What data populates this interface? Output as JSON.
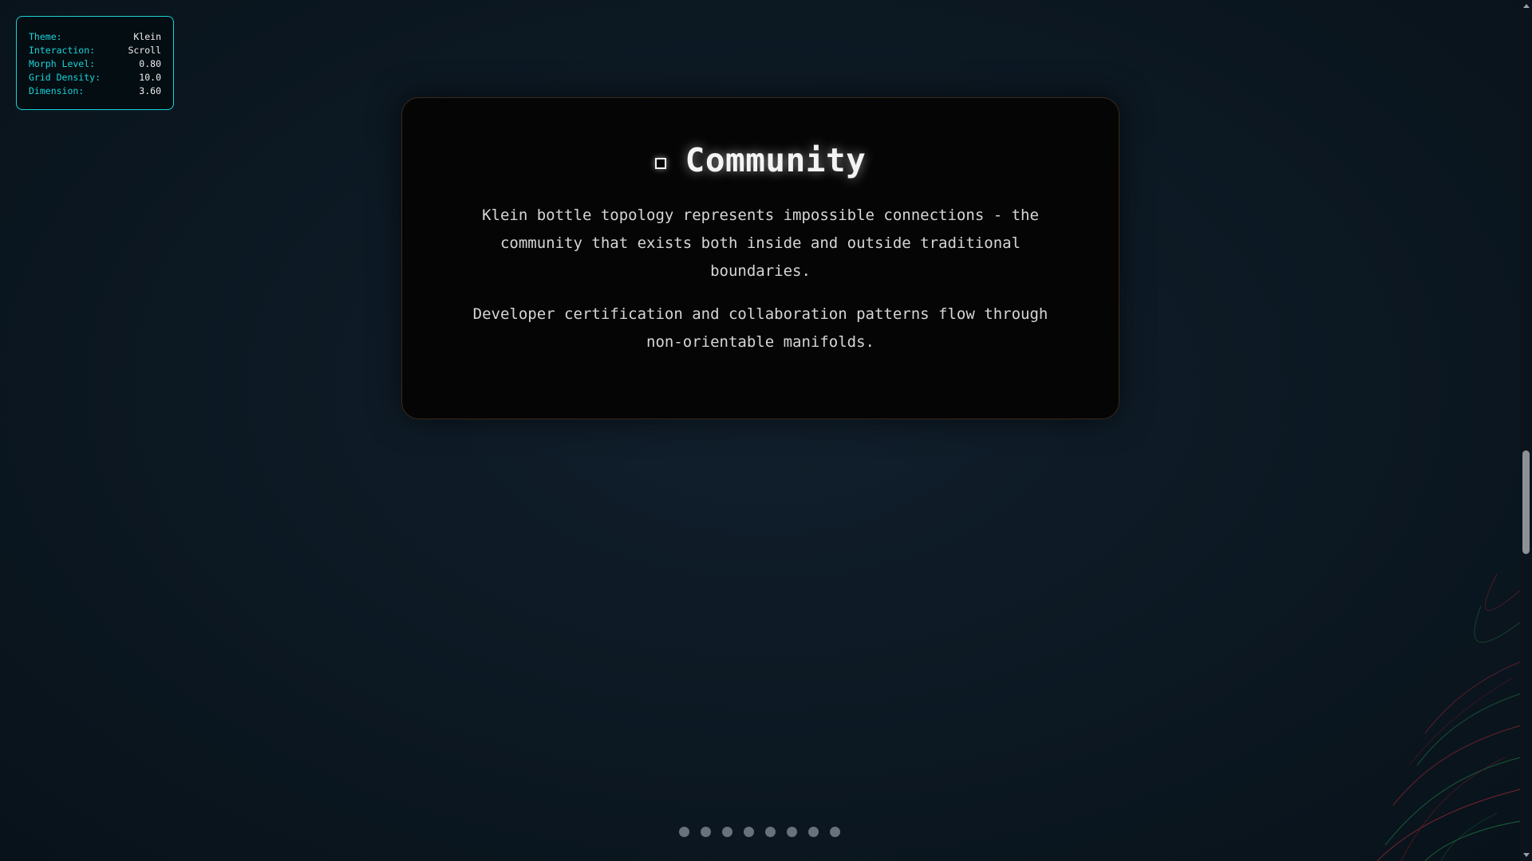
{
  "params": {
    "theme_label": "Theme:",
    "theme_value": "Klein",
    "interaction_label": "Interaction:",
    "interaction_value": "Scroll",
    "morph_label": "Morph Level:",
    "morph_value": "0.80",
    "grid_label": "Grid Density:",
    "grid_value": "10.0",
    "dimension_label": "Dimension:",
    "dimension_value": "3.60"
  },
  "card": {
    "icon": "square-icon",
    "title": "Community",
    "paragraph1": "Klein bottle topology represents impossible connections - the community that exists both inside and outside traditional boundaries.",
    "paragraph2": "Developer certification and collaboration patterns flow through non-orientable manifolds."
  },
  "pager": {
    "count": 8
  },
  "colors": {
    "accent": "#19d3d8",
    "background": "#0c1822",
    "card": "#050506"
  }
}
